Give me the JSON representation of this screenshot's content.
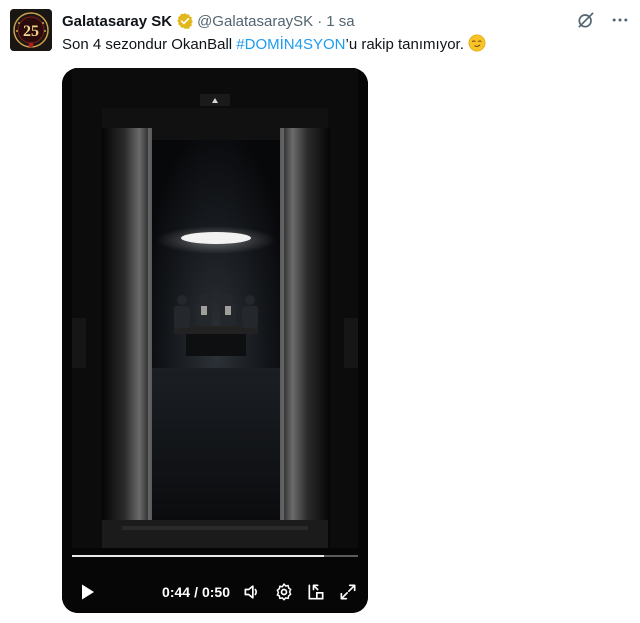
{
  "author": {
    "name": "Galatasaray SK",
    "handle": "@GalatasaraySK",
    "separator": "·",
    "time": "1 sa",
    "avatar_text": "25"
  },
  "tweet": {
    "text_before": "Son 4 sezondur OkanBall ",
    "hashtag": "#DOMİN4SYON",
    "text_after": "’u rakip tanımıyor."
  },
  "video": {
    "current_time": "0:44",
    "time_separator": "/",
    "duration": "0:50",
    "progress": 0.88
  },
  "icons": {
    "verified": "verified-badge-icon",
    "grok": "grok-icon",
    "more": "more-options-icon",
    "emoji": "smirking-face-emoji",
    "play": "play-icon",
    "volume": "volume-icon",
    "settings": "settings-gear-icon",
    "pip": "picture-in-picture-icon",
    "fullscreen": "fullscreen-icon"
  },
  "colors": {
    "hashtag": "#1d9bf0",
    "verified_gold": "#e2b719",
    "muted_text": "#536471"
  }
}
